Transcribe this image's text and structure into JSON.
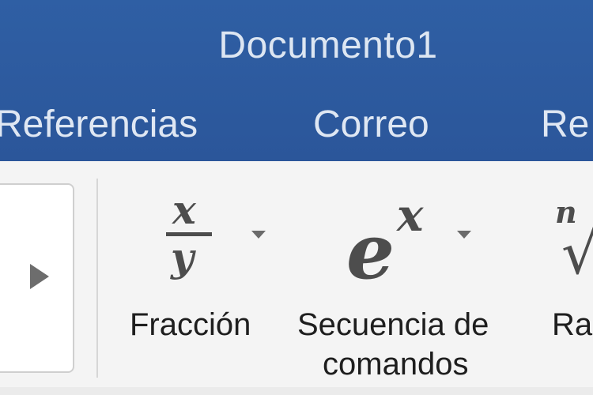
{
  "window": {
    "title": "Documento1"
  },
  "tabs": [
    {
      "label": "Referencias"
    },
    {
      "label": "Correo"
    },
    {
      "label": "Re"
    }
  ],
  "ribbon": {
    "buttons": [
      {
        "name": "Fracción",
        "label": "Fracción",
        "icon": {
          "numerator": "x",
          "denominator": "y"
        }
      },
      {
        "name": "Secuencia de comandos",
        "label_line1": "Secuencia de",
        "label_line2": "comandos",
        "icon": {
          "base": "e",
          "superscript": "x"
        }
      },
      {
        "name": "Radical",
        "label": "Ra",
        "icon": {
          "index": "n",
          "symbol": "√"
        }
      }
    ]
  },
  "colors": {
    "titlebar": "#2d5a9c",
    "ribbon": "#f4f4f4",
    "icon": "#4d4d4d",
    "text": "#1e1e1e"
  }
}
